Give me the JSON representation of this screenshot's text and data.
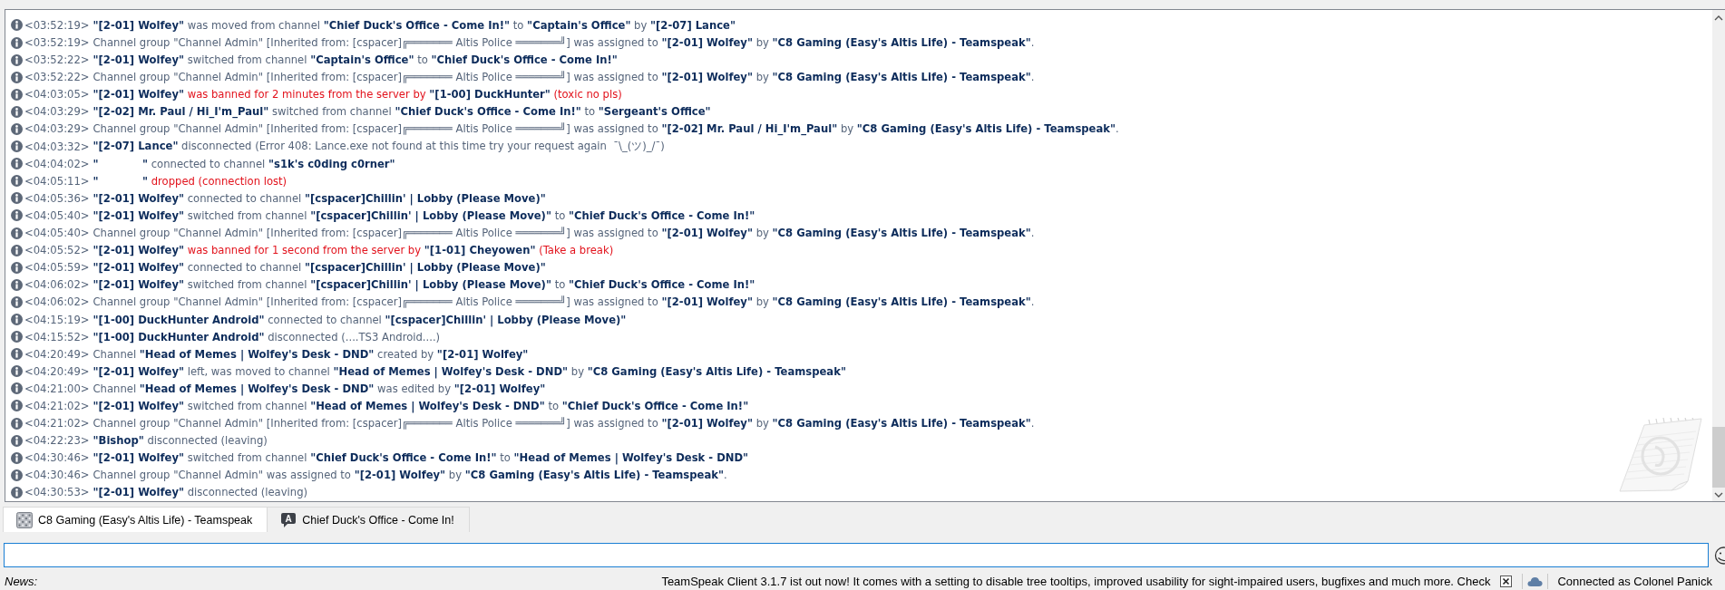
{
  "log": {
    "lines": [
      {
        "kind": "info",
        "time": "<03:52:19>",
        "message": "**\"[2-01] Wolfey\"** was moved from channel **\"Chief Duck's Office - Come In!\"** to **\"Captain's Office\"** by **\"[2-07] Lance\"**"
      },
      {
        "kind": "info",
        "time": "<03:52:19>",
        "message": "Channel group \"Channel Admin\" [Inherited from: [cspacer]╔═══════ Altis Police ═══════╝] was assigned to **\"[2-01] Wolfey\"** by **\"C8 Gaming (Easy's Altis Life) - Teamspeak\"**."
      },
      {
        "kind": "info",
        "time": "<03:52:22>",
        "message": "**\"[2-01] Wolfey\"** switched from channel **\"Captain's Office\"** to **\"Chief Duck's Office - Come In!\"**"
      },
      {
        "kind": "info",
        "time": "<03:52:22>",
        "message": "Channel group \"Channel Admin\" [Inherited from: [cspacer]╔═══════ Altis Police ═══════╝] was assigned to **\"[2-01] Wolfey\"** by **\"C8 Gaming (Easy's Altis Life) - Teamspeak\"**."
      },
      {
        "kind": "error",
        "time": "<04:03:05>",
        "message": "**\"[2-01] Wolfey\"** was banned for 2 minutes from the server by **\"[1-00] DuckHunter\"** (toxic no pls)"
      },
      {
        "kind": "info",
        "time": "<04:03:29>",
        "message": "**\"[2-02] Mr. Paul / Hi_I'm_Paul\"** switched from channel **\"Chief Duck's Office - Come In!\"** to **\"Sergeant's Office\"**"
      },
      {
        "kind": "info",
        "time": "<04:03:29>",
        "message": "Channel group \"Channel Admin\" [Inherited from: [cspacer]╔═══════ Altis Police ═══════╝] was assigned to **\"[2-02] Mr. Paul / Hi_I'm_Paul\"** by **\"C8 Gaming (Easy's Altis Life) - Teamspeak\"**."
      },
      {
        "kind": "info",
        "time": "<04:03:32>",
        "message": "**\"[2-07] Lance\"** disconnected (Error 408: Lance.exe not found at this time try your request again  ¯\\_(ツ)_/¯)"
      },
      {
        "kind": "info",
        "time": "<04:04:02>",
        "message": "**\"            \"** connected to channel **\"s1k's c0ding c0rner\"**"
      },
      {
        "kind": "error",
        "time": "<04:05:11>",
        "message": "**\"            \"** dropped (connection lost)"
      },
      {
        "kind": "info",
        "time": "<04:05:36>",
        "message": "**\"[2-01] Wolfey\"** connected to channel **\"[cspacer]Chillin' | Lobby (Please Move)\"**"
      },
      {
        "kind": "info",
        "time": "<04:05:40>",
        "message": "**\"[2-01] Wolfey\"** switched from channel **\"[cspacer]Chillin' | Lobby (Please Move)\"** to **\"Chief Duck's Office - Come In!\"**"
      },
      {
        "kind": "info",
        "time": "<04:05:40>",
        "message": "Channel group \"Channel Admin\" [Inherited from: [cspacer]╔═══════ Altis Police ═══════╝] was assigned to **\"[2-01] Wolfey\"** by **\"C8 Gaming (Easy's Altis Life) - Teamspeak\"**."
      },
      {
        "kind": "error",
        "time": "<04:05:52>",
        "message": "**\"[2-01] Wolfey\"** was banned for 1 second from the server by **\"[1-01] Cheyowen\"** (Take a break)"
      },
      {
        "kind": "info",
        "time": "<04:05:59>",
        "message": "**\"[2-01] Wolfey\"** connected to channel **\"[cspacer]Chillin' | Lobby (Please Move)\"**"
      },
      {
        "kind": "info",
        "time": "<04:06:02>",
        "message": "**\"[2-01] Wolfey\"** switched from channel **\"[cspacer]Chillin' | Lobby (Please Move)\"** to **\"Chief Duck's Office - Come In!\"**"
      },
      {
        "kind": "info",
        "time": "<04:06:02>",
        "message": "Channel group \"Channel Admin\" [Inherited from: [cspacer]╔═══════ Altis Police ═══════╝] was assigned to **\"[2-01] Wolfey\"** by **\"C8 Gaming (Easy's Altis Life) - Teamspeak\"**."
      },
      {
        "kind": "info",
        "time": "<04:15:19>",
        "message": "**\"[1-00] DuckHunter Android\"** connected to channel **\"[cspacer]Chillin' | Lobby (Please Move)\"**"
      },
      {
        "kind": "info",
        "time": "<04:15:52>",
        "message": "**\"[1-00] DuckHunter Android\"** disconnected (....TS3 Android....)"
      },
      {
        "kind": "info",
        "time": "<04:20:49>",
        "message": "Channel **\"Head of Memes | Wolfey's Desk - DND\"** created by **\"[2-01] Wolfey\"**"
      },
      {
        "kind": "info",
        "time": "<04:20:49>",
        "message": "**\"[2-01] Wolfey\"** left, was moved to channel **\"Head of Memes | Wolfey's Desk - DND\"** by **\"C8 Gaming (Easy's Altis Life) - Teamspeak\"**"
      },
      {
        "kind": "info",
        "time": "<04:21:00>",
        "message": "Channel **\"Head of Memes | Wolfey's Desk - DND\"** was edited by **\"[2-01] Wolfey\"**"
      },
      {
        "kind": "info",
        "time": "<04:21:02>",
        "message": "**\"[2-01] Wolfey\"** switched from channel **\"Head of Memes | Wolfey's Desk - DND\"** to **\"Chief Duck's Office - Come In!\"**"
      },
      {
        "kind": "info",
        "time": "<04:21:02>",
        "message": "Channel group \"Channel Admin\" [Inherited from: [cspacer]╔═══════ Altis Police ═══════╝] was assigned to **\"[2-01] Wolfey\"** by **\"C8 Gaming (Easy's Altis Life) - Teamspeak\"**."
      },
      {
        "kind": "info",
        "time": "<04:22:23>",
        "message": "**\"Bishop\"** disconnected (leaving)"
      },
      {
        "kind": "info",
        "time": "<04:30:46>",
        "message": "**\"[2-01] Wolfey\"** switched from channel **\"Chief Duck's Office - Come In!\"** to **\"Head of Memes | Wolfey's Desk - DND\"**"
      },
      {
        "kind": "info",
        "time": "<04:30:46>",
        "message": "Channel group \"Channel Admin\" was assigned to **\"[2-01] Wolfey\"** by **\"C8 Gaming (Easy's Altis Life) - Teamspeak\"**."
      },
      {
        "kind": "info",
        "time": "<04:30:53>",
        "message": "**\"[2-01] Wolfey\"** disconnected (leaving)"
      }
    ]
  },
  "tabs": [
    {
      "kind": "server",
      "label": "C8 Gaming (Easy's Altis Life) - Teamspeak",
      "selected": true
    },
    {
      "kind": "channel",
      "badge": "A",
      "label": "Chief Duck's Office - Come In!",
      "selected": false
    }
  ],
  "status_bar": {
    "news_label": "News:",
    "news": "TeamSpeak Client 3.1.7 ist out now! It comes with a setting to disable tree tooltips, improved usability for sight-impaired users, bugfixes and much more. Check",
    "connection": "Connected as Colonel Panick"
  }
}
